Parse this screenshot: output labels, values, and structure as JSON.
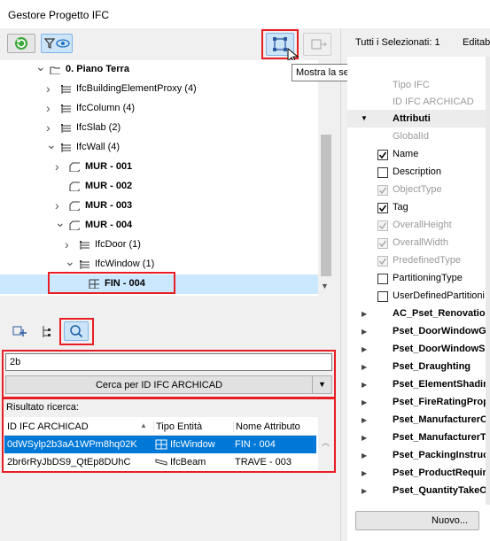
{
  "window": {
    "title": "Gestore Progetto IFC"
  },
  "tooltip": "Mostra la selezione della lista nel modello",
  "tree": {
    "items": [
      {
        "label": "0. Piano Terra",
        "bold": true
      },
      {
        "label": "IfcBuildingElementProxy (4)"
      },
      {
        "label": "IfcColumn (4)"
      },
      {
        "label": "IfcSlab (2)"
      },
      {
        "label": "IfcWall (4)"
      },
      {
        "label": "MUR - 001",
        "bold": true
      },
      {
        "label": "MUR - 002",
        "bold": true
      },
      {
        "label": "MUR - 003",
        "bold": true
      },
      {
        "label": "MUR - 004",
        "bold": true
      },
      {
        "label": "IfcDoor (1)"
      },
      {
        "label": "IfcWindow (1)"
      },
      {
        "label": "FIN - 004",
        "bold": true,
        "selected": true
      }
    ]
  },
  "search": {
    "value": "2b",
    "mode_label": "Cerca per ID IFC ARCHICAD",
    "result_label": "Risultato ricerca:",
    "columns": [
      "ID IFC ARCHICAD",
      "Tipo Entità",
      "Nome Attributo"
    ],
    "rows": [
      {
        "id": "0dWSylp2b3aA1WPm8hq02K",
        "type": "IfcWindow",
        "name": "FIN - 004",
        "selected": true
      },
      {
        "id": "2br6rRyJbDS9_QtEp8DUhC",
        "type": "IfcBeam",
        "name": "TRAVE - 003"
      }
    ]
  },
  "right": {
    "header_selected": "Tutti i Selezionati: 1",
    "header_edit": "Editab",
    "tipo_ifc": "Tipo IFC",
    "id_ifc": "ID IFC ARCHICAD",
    "attributi": "Attributi",
    "attributes": [
      {
        "label": "GlobalId",
        "checkbox": "none",
        "disabled": true
      },
      {
        "label": "Name",
        "checkbox": "checked"
      },
      {
        "label": "Description",
        "checkbox": "unchecked"
      },
      {
        "label": "ObjectType",
        "checkbox": "checked",
        "disabled": true
      },
      {
        "label": "Tag",
        "checkbox": "checked"
      },
      {
        "label": "OverallHeight",
        "checkbox": "checked",
        "disabled": true
      },
      {
        "label": "OverallWidth",
        "checkbox": "checked",
        "disabled": true
      },
      {
        "label": "PredefinedType",
        "checkbox": "checked",
        "disabled": true
      },
      {
        "label": "PartitioningType",
        "checkbox": "unchecked"
      },
      {
        "label": "UserDefinedPartitioni",
        "checkbox": "unchecked"
      }
    ],
    "psets": [
      "AC_Pset_RenovationA",
      "Pset_DoorWindowGla",
      "Pset_DoorWindowSh",
      "Pset_Draughting",
      "Pset_ElementShading",
      "Pset_FireRatingPrope",
      "Pset_ManufacturerOc",
      "Pset_ManufacturerTy",
      "Pset_PackingInstructi",
      "Pset_ProductRequirer",
      "Pset_QuantityTakeOff"
    ],
    "new_button": "Nuovo..."
  }
}
